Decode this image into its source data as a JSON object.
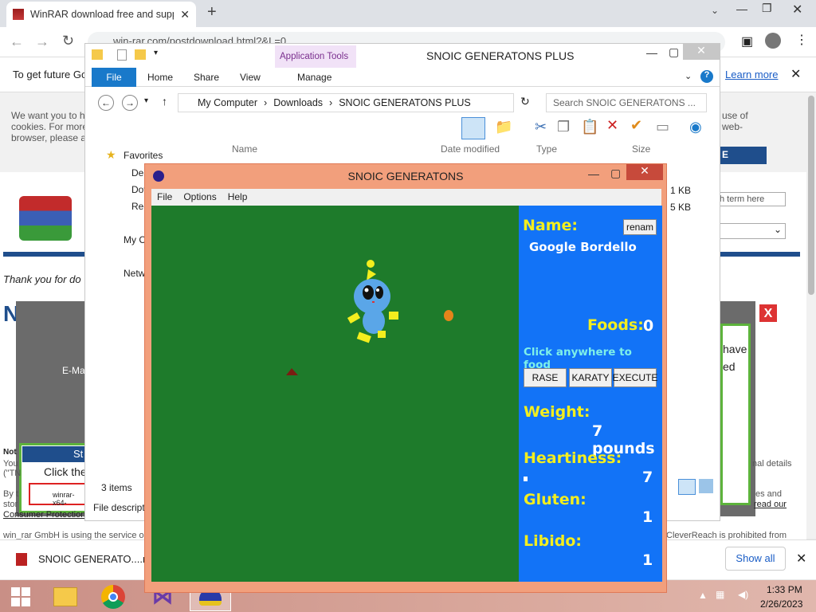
{
  "browser": {
    "tab_title": "WinRAR download free and supp",
    "url": "win-rar.com/postdownload.html?&L=0",
    "infobar_text": "To get future Go",
    "learn_more": "Learn more"
  },
  "webpage": {
    "left_text": "We want you to h\ncookies. For more\nbrowser, please a",
    "right_text": "use of\nweb-",
    "button_fragment": "E",
    "search_placeholder": "h term here",
    "thanks": "Thank you for do",
    "now_get": "Now ge",
    "email": "E-Ma",
    "popup_title": "St",
    "popup_text": "Click the",
    "popup_file": "winrar-x64-",
    "have": "have",
    "ed": "ed",
    "note": "Not",
    "you": "You",
    "tm": "(\"TN",
    "by": "By t",
    "stor": "stor",
    "consumer": "Consumer Protection",
    "nal": "nal details",
    "es_and": "es and",
    "read_our": "read our",
    "footer_left": "win_rar GmbH is using the service o",
    "footer_right": "CleverReach is prohibited from",
    "close_x": "X"
  },
  "explorer": {
    "title": "SNOIC GENERATONS PLUS",
    "app_tools": "Application Tools",
    "tabs": [
      "File",
      "Home",
      "Share",
      "View",
      "Manage"
    ],
    "path": [
      "My Computer",
      "Downloads",
      "SNOIC GENERATONS PLUS"
    ],
    "search_placeholder": "Search SNOIC GENERATONS ...",
    "columns": [
      "Name",
      "Date modified",
      "Type",
      "Size"
    ],
    "nav": [
      "Favorites",
      "Des",
      "Dov",
      "Rec",
      "My C",
      "Netw"
    ],
    "sizes": [
      "1 KB",
      "5 KB"
    ],
    "status_items": "3 items",
    "status_desc": "File descripti"
  },
  "game": {
    "title": "SNOIC GENERATONS",
    "menu": [
      "File",
      "Options",
      "Help"
    ],
    "name_label": "Name:",
    "rename": "renam",
    "name": "Google Bordello",
    "foods_label": "Foods:",
    "foods": "0",
    "hint": "Click anywhere to food",
    "buttons": [
      "RASE",
      "KARATY",
      "EXECUTE"
    ],
    "weight_label": "Weight:",
    "weight": "7 pounds",
    "heart_label": "Heartiness:",
    "heart": "7",
    "heart_progress": 0.04,
    "gluten_label": "Gluten:",
    "gluten": "1",
    "libido_label": "Libido:",
    "libido": "1"
  },
  "download": {
    "file": "SNOIC GENERATO....rar",
    "show_all": "Show all"
  },
  "taskbar": {
    "time": "1:33 PM",
    "date": "2/26/2023"
  },
  "colors": {
    "panel": "#1273f7",
    "field": "#1e7b2b",
    "accent_yellow": "#f3ee1e",
    "winrar_blue": "#1f4e8c"
  }
}
